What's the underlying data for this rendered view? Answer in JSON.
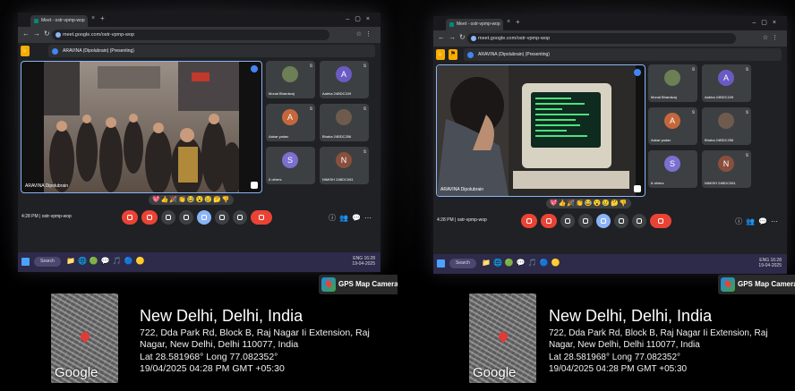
{
  "photos": [
    {
      "browser": {
        "tab_title": "Meet - ostr-vpmp-wop",
        "url": "meet.google.com/ostr-vpmp-wop"
      },
      "meet": {
        "presenting_label": "ARAVINA (Dipolubrain) (Presenting)",
        "stage_label": "ARAVINA Dipolubrain",
        "participants": [
          {
            "initial": "",
            "name": "Monal Bhardwaj",
            "color": "#6d7f54"
          },
          {
            "initial": "A",
            "name": "Aabha 24BDC249",
            "color": "#6a5bc4"
          },
          {
            "initial": "A",
            "name": "Aakar yadav",
            "color": "#c5673c"
          },
          {
            "initial": "",
            "name": "Bhaha 24BDC256",
            "color": "#6e5b4d"
          },
          {
            "initial": "S",
            "name": "8 others",
            "color": "#7b6fd0"
          },
          {
            "initial": "N",
            "name": "NIMISH 24BDC081",
            "color": "#8a4f3c"
          }
        ],
        "reactions": "💖👍🎉👏😂😮😢🤔👎",
        "time_and_code": "4:28 PM  |  ostr-vpmp-wop"
      },
      "taskbar": {
        "search": "Search",
        "apps": "📁🌐🟢💬🎵🔵🟡",
        "clock_line1": "ENG 16:28",
        "clock_line2": "19-04-2025"
      },
      "gps": {
        "chip": "GPS Map Camera",
        "google": "Google",
        "title": "New Delhi, Delhi, India",
        "lines": [
          "722, Dda Park Rd, Block B, Raj Nagar Ii Extension, Raj",
          "Nagar, New Delhi, Delhi 110077, India",
          "Lat 28.581968° Long 77.082352°",
          "19/04/2025 04:28 PM GMT +05:30"
        ]
      }
    },
    {
      "browser": {
        "tab_title": "Meet - ostr-vpmp-wop",
        "url": "meet.google.com/ostr-vpmp-wop"
      },
      "meet": {
        "presenting_label": "ARAVINA (Dipolubrain) (Presenting)",
        "stage_label": "ARAVINA Dipolubrain",
        "participants": [
          {
            "initial": "",
            "name": "Monal Bhardwaj",
            "color": "#6d7f54"
          },
          {
            "initial": "A",
            "name": "Aabha 24BDC249",
            "color": "#6a5bc4"
          },
          {
            "initial": "A",
            "name": "Aakar yadav",
            "color": "#c5673c"
          },
          {
            "initial": "",
            "name": "Bhaha 24BDC256",
            "color": "#6e5b4d"
          },
          {
            "initial": "S",
            "name": "8 others",
            "color": "#7b6fd0"
          },
          {
            "initial": "N",
            "name": "NIMISH 24BDC081",
            "color": "#8a4f3c"
          }
        ],
        "reactions": "💖👍🎉👏😂😮😢🤔👎",
        "time_and_code": "4:28 PM  |  ostr-vpmp-wop"
      },
      "taskbar": {
        "search": "Search",
        "apps": "📁🌐🟢💬🎵🔵🟡",
        "clock_line1": "ENG 16:28",
        "clock_line2": "19-04-2025"
      },
      "gps": {
        "chip": "GPS Map Camera",
        "google": "Google",
        "title": "New Delhi, Delhi, India",
        "lines": [
          "722, Dda Park Rd, Block B, Raj Nagar Ii Extension, Raj",
          "Nagar, New Delhi, Delhi 110077, India",
          "Lat 28.581968° Long 77.082352°",
          "19/04/2025 04:28 PM GMT +05:30"
        ]
      }
    }
  ],
  "colors": {
    "meet_bg": "#202124",
    "accent": "#8ab4f8",
    "end_call": "#ea4335",
    "taskbar": "#2d2a4a"
  }
}
